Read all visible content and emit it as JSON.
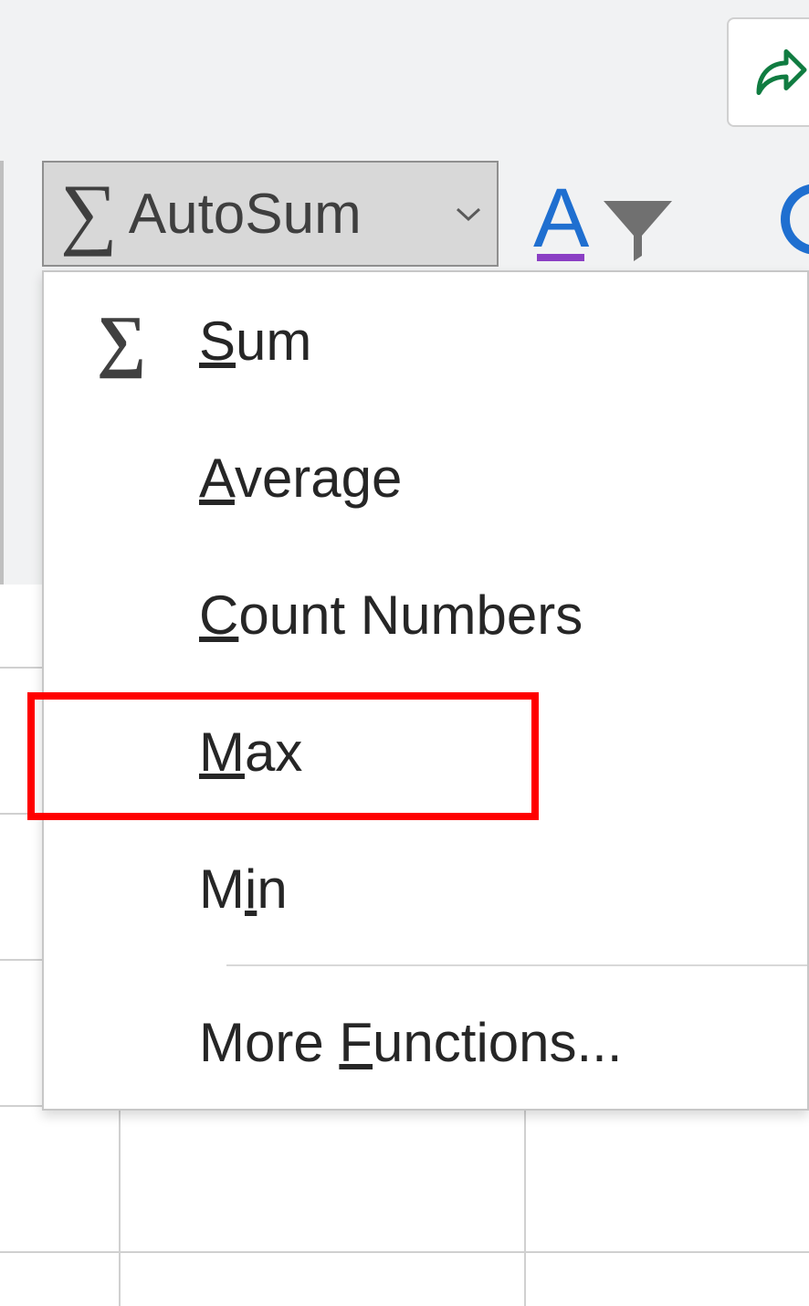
{
  "ribbon": {
    "autosum_label": "AutoSum"
  },
  "menu": {
    "sum": {
      "u": "S",
      "rest": "um"
    },
    "average": {
      "u": "A",
      "rest": "verage"
    },
    "count": {
      "u": "C",
      "rest": "ount Numbers"
    },
    "max": {
      "u": "M",
      "rest": "ax"
    },
    "min": {
      "pre": "M",
      "u": "i",
      "rest": "n"
    },
    "more": {
      "pre": "More ",
      "u": "F",
      "rest": "unctions..."
    }
  }
}
